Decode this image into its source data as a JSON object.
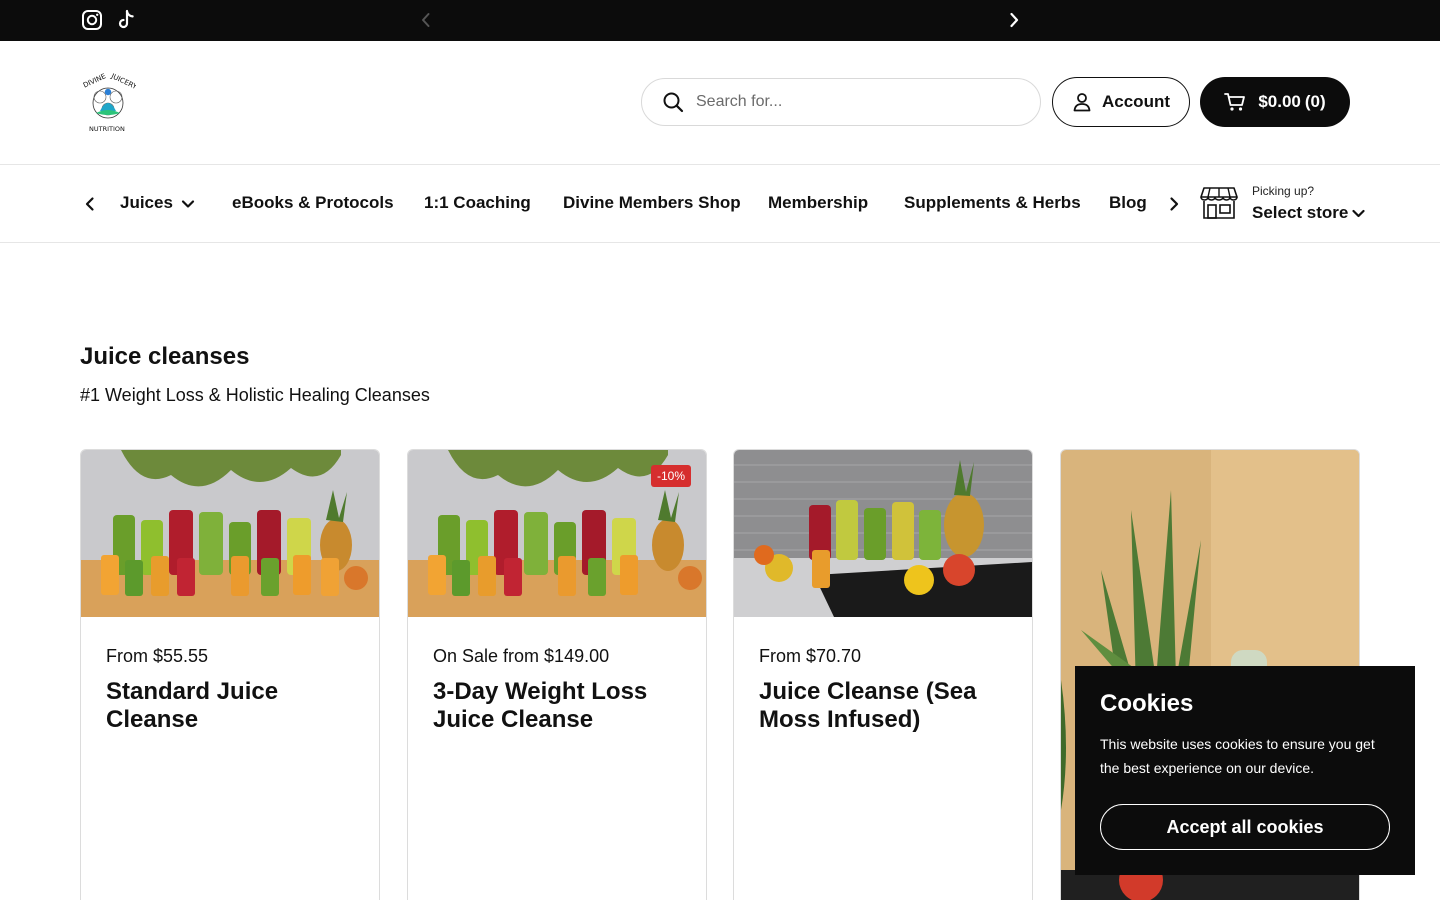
{
  "topbar": {
    "social": [
      {
        "icon": "instagram-icon"
      },
      {
        "icon": "tiktok-icon"
      }
    ]
  },
  "header": {
    "logo_alt": "Divine Juicery Nutrition",
    "search": {
      "placeholder": "Search for..."
    },
    "account_label": "Account",
    "cart": {
      "total": "$0.00",
      "count": "(0)"
    }
  },
  "nav": {
    "items": [
      {
        "label": "Juices",
        "has_dropdown": true
      },
      {
        "label": "eBooks & Protocols"
      },
      {
        "label": "1:1 Coaching"
      },
      {
        "label": "Divine Members Shop"
      },
      {
        "label": "Membership"
      },
      {
        "label": "Supplements & Herbs"
      },
      {
        "label": "Blog"
      }
    ],
    "store": {
      "picking_label": "Picking up?",
      "select_label": "Select store"
    }
  },
  "collection": {
    "title": "Juice cleanses",
    "subtitle": "#1 Weight Loss & Holistic Healing Cleanses"
  },
  "products": [
    {
      "price": "From $55.55",
      "title": "Standard Juice Cleanse"
    },
    {
      "price": "On Sale from $149.00",
      "title": "3-Day Weight Loss Juice Cleanse",
      "badge": "-10%"
    },
    {
      "price": "From $70.70",
      "title": "Juice Cleanse (Sea Moss Infused)"
    },
    {
      "price": "",
      "title": ""
    }
  ],
  "cookie": {
    "title": "Cookies",
    "text": "This website uses cookies to ensure you get the best experience on our device.",
    "accept_label": "Accept all cookies"
  },
  "colors": {
    "bar": "#0c0c0c",
    "sale_badge": "#d62e2e",
    "border": "#dcdcdc"
  }
}
